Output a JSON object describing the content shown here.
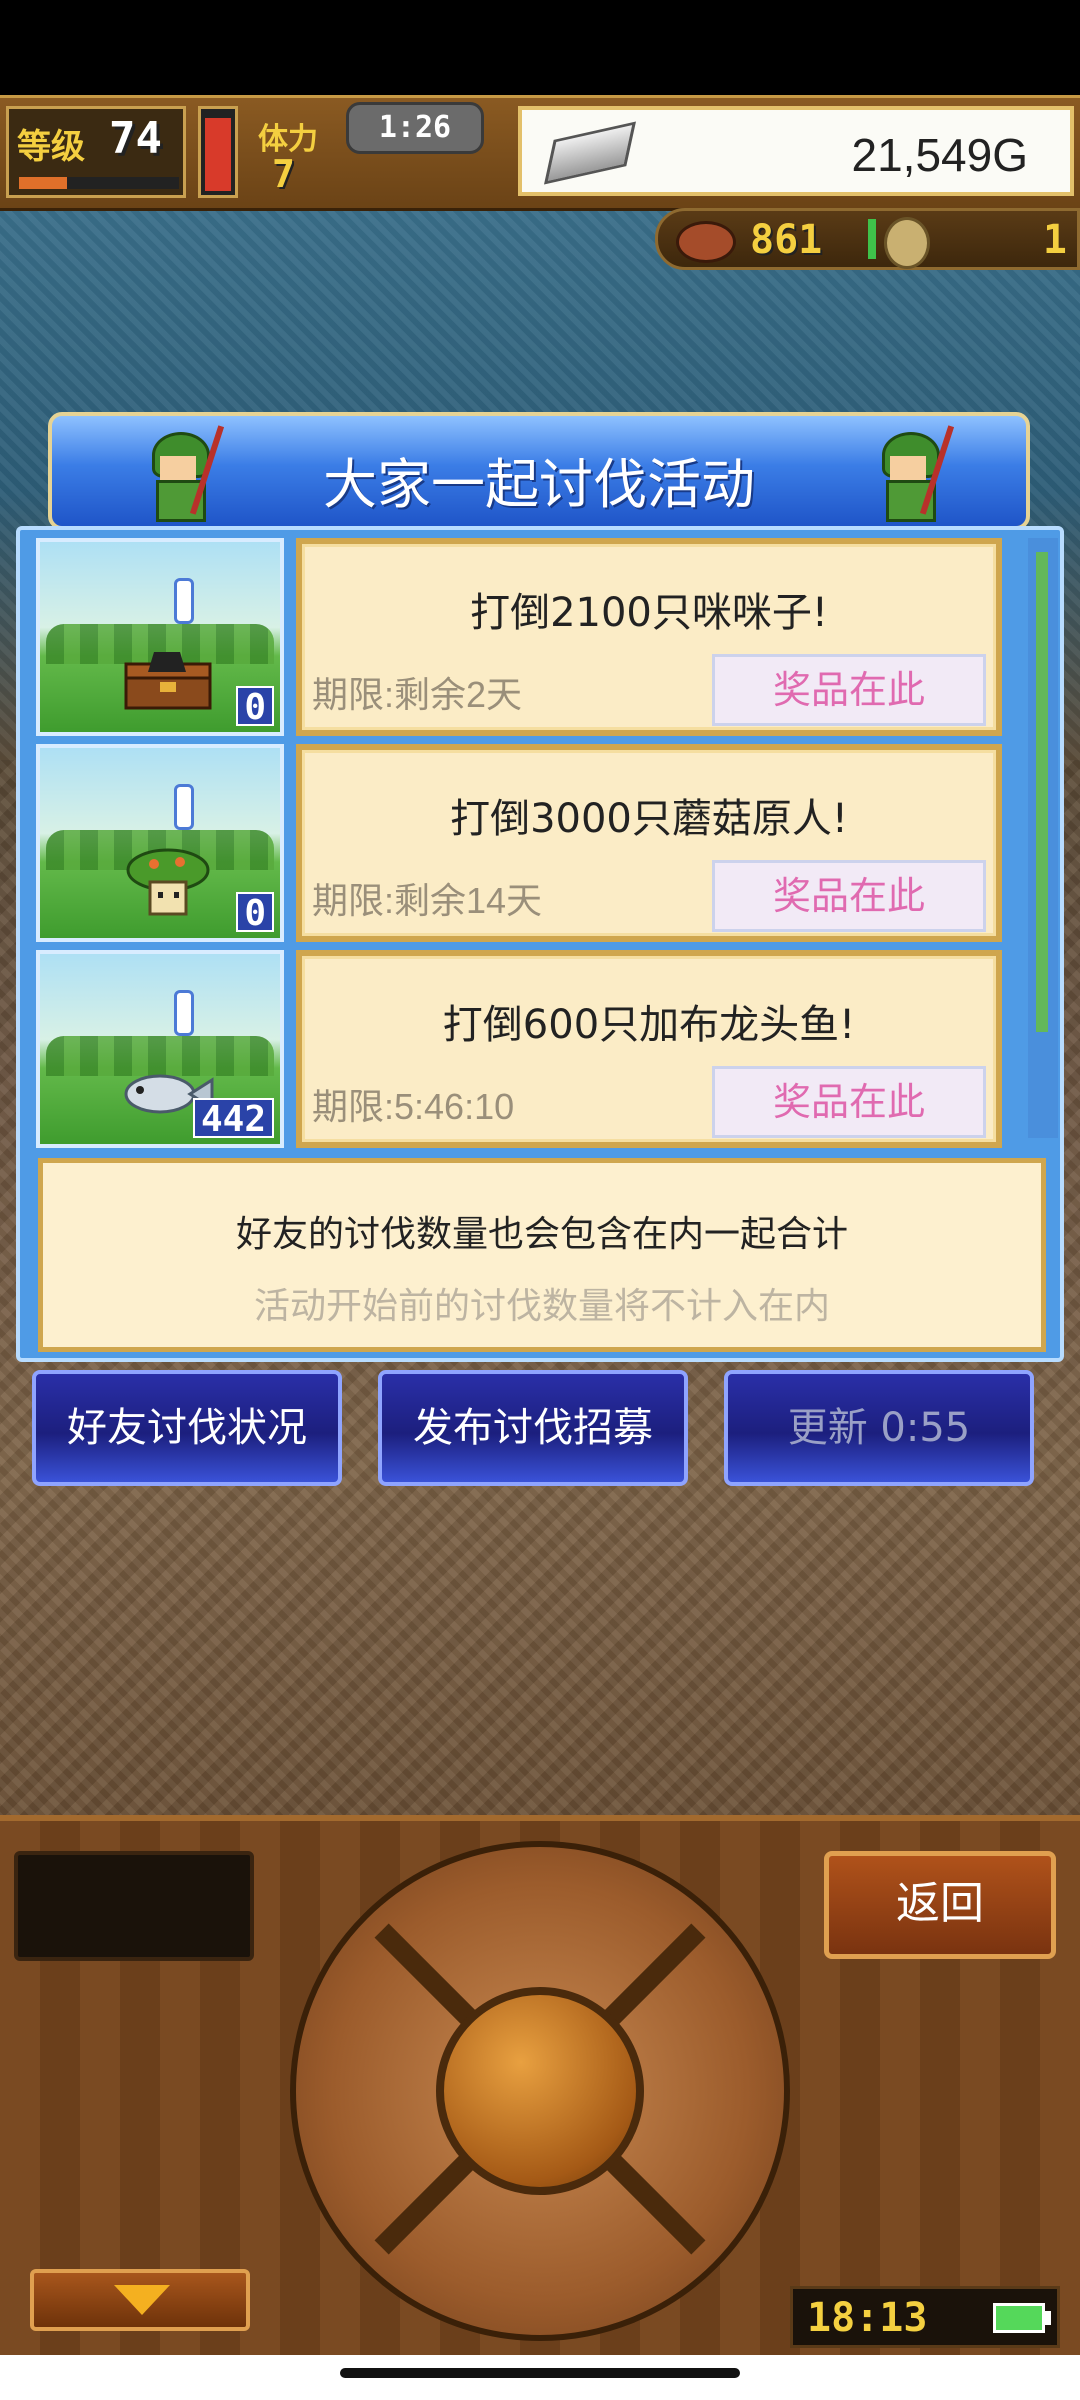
{
  "hud": {
    "level_label": "等级",
    "level": "74",
    "level_progress": 0.3,
    "stamina_level": 0.85,
    "friend_label": "体力",
    "friend_count": "7",
    "timer": "1:26",
    "gold": "21,549G",
    "sub_count": "861",
    "sub_right": "1"
  },
  "event": {
    "title": "大家一起讨伐活动",
    "quests": [
      {
        "title": "打倒2100只咪咪子!",
        "deadline": "期限:剩余2天",
        "count": "0",
        "prize": "奖品在此"
      },
      {
        "title": "打倒3000只蘑菇原人!",
        "deadline": "期限:剩余14天",
        "count": "0",
        "prize": "奖品在此"
      },
      {
        "title": "打倒600只加布龙头鱼!",
        "deadline": "期限:5:46:10",
        "count": "442",
        "prize": "奖品在此"
      }
    ],
    "notice_line1": "好友的讨伐数量也会包含在内一起合计",
    "notice_line2": "活动开始前的讨伐数量将不计入在内"
  },
  "actions": {
    "friend_status": "好友讨伐状况",
    "post_recruit": "发布讨伐招募",
    "refresh": "更新 0:55"
  },
  "controls": {
    "back": "返回",
    "clock": "18:13"
  },
  "colors": {
    "banner_blue": "#3b7de6",
    "prize_pink": "#e06ab0",
    "card_bg": "#fbecc6"
  }
}
